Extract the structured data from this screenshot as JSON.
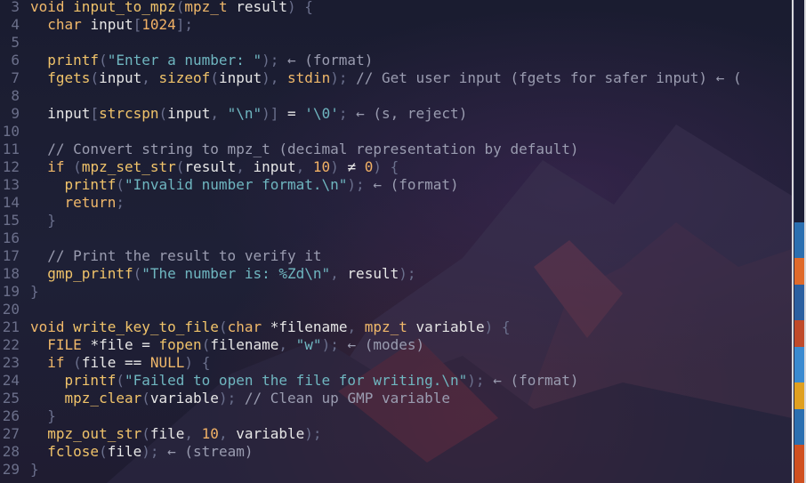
{
  "editor": {
    "lines": [
      {
        "n": "3",
        "tokens": [
          [
            "kw",
            "void "
          ],
          [
            "fn",
            "input_to_mpz"
          ],
          [
            "pn",
            "("
          ],
          [
            "ty",
            "mpz_t "
          ],
          [
            "id",
            "result"
          ],
          [
            "pn",
            ") {"
          ]
        ]
      },
      {
        "n": "4",
        "tokens": [
          [
            "id",
            "  "
          ],
          [
            "ty",
            "char "
          ],
          [
            "id",
            "input"
          ],
          [
            "pn",
            "["
          ],
          [
            "num",
            "1024"
          ],
          [
            "pn",
            "];"
          ]
        ]
      },
      {
        "n": "5",
        "tokens": []
      },
      {
        "n": "6",
        "tokens": [
          [
            "id",
            "  "
          ],
          [
            "fn",
            "printf"
          ],
          [
            "pn",
            "("
          ],
          [
            "str",
            "\"Enter a number: \""
          ],
          [
            "pn",
            "); "
          ],
          [
            "hint",
            "← (format)"
          ]
        ]
      },
      {
        "n": "7",
        "tokens": [
          [
            "id",
            "  "
          ],
          [
            "fn",
            "fgets"
          ],
          [
            "pn",
            "("
          ],
          [
            "id",
            "input"
          ],
          [
            "pn",
            ", "
          ],
          [
            "fn",
            "sizeof"
          ],
          [
            "pn",
            "("
          ],
          [
            "id",
            "input"
          ],
          [
            "pn",
            "), "
          ],
          [
            "ty",
            "stdin"
          ],
          [
            "pn",
            "); "
          ],
          [
            "cmt",
            "// Get user input (fgets for safer input) ← ("
          ]
        ]
      },
      {
        "n": "8",
        "tokens": []
      },
      {
        "n": "9",
        "tokens": [
          [
            "id",
            "  input"
          ],
          [
            "pn",
            "["
          ],
          [
            "fn",
            "strcspn"
          ],
          [
            "pn",
            "("
          ],
          [
            "id",
            "input"
          ],
          [
            "pn",
            ", "
          ],
          [
            "str",
            "\"\\n\""
          ],
          [
            "pn",
            ")] "
          ],
          [
            "op",
            "= "
          ],
          [
            "str",
            "'\\0'"
          ],
          [
            "pn",
            "; "
          ],
          [
            "hint",
            "← (s, reject)"
          ]
        ]
      },
      {
        "n": "10",
        "tokens": []
      },
      {
        "n": "11",
        "tokens": [
          [
            "cmt",
            "  // Convert string to mpz_t (decimal representation by default)"
          ]
        ]
      },
      {
        "n": "12",
        "tokens": [
          [
            "id",
            "  "
          ],
          [
            "kw",
            "if "
          ],
          [
            "pn",
            "("
          ],
          [
            "fn",
            "mpz_set_str"
          ],
          [
            "pn",
            "("
          ],
          [
            "id",
            "result"
          ],
          [
            "pn",
            ", "
          ],
          [
            "id",
            "input"
          ],
          [
            "pn",
            ", "
          ],
          [
            "num",
            "10"
          ],
          [
            "pn",
            ") "
          ],
          [
            "op",
            "≠ "
          ],
          [
            "num",
            "0"
          ],
          [
            "pn",
            ") {"
          ]
        ]
      },
      {
        "n": "13",
        "tokens": [
          [
            "id",
            "    "
          ],
          [
            "fn",
            "printf"
          ],
          [
            "pn",
            "("
          ],
          [
            "str",
            "\"Invalid number format.\\n\""
          ],
          [
            "pn",
            "); "
          ],
          [
            "hint",
            "← (format)"
          ]
        ]
      },
      {
        "n": "14",
        "tokens": [
          [
            "id",
            "    "
          ],
          [
            "kw",
            "return"
          ],
          [
            "pn",
            ";"
          ]
        ]
      },
      {
        "n": "15",
        "tokens": [
          [
            "pn",
            "  }"
          ]
        ]
      },
      {
        "n": "16",
        "tokens": []
      },
      {
        "n": "17",
        "tokens": [
          [
            "cmt",
            "  // Print the result to verify it"
          ]
        ]
      },
      {
        "n": "18",
        "tokens": [
          [
            "id",
            "  "
          ],
          [
            "fn",
            "gmp_printf"
          ],
          [
            "pn",
            "("
          ],
          [
            "str",
            "\"The number is: %Zd\\n\""
          ],
          [
            "pn",
            ", "
          ],
          [
            "id",
            "result"
          ],
          [
            "pn",
            ");"
          ]
        ]
      },
      {
        "n": "19",
        "tokens": [
          [
            "pn",
            "}"
          ]
        ]
      },
      {
        "n": "20",
        "tokens": []
      },
      {
        "n": "21",
        "tokens": [
          [
            "kw",
            "void "
          ],
          [
            "fn",
            "write_key_to_file"
          ],
          [
            "pn",
            "("
          ],
          [
            "ty",
            "char "
          ],
          [
            "op",
            "*"
          ],
          [
            "id",
            "filename"
          ],
          [
            "pn",
            ", "
          ],
          [
            "ty",
            "mpz_t "
          ],
          [
            "id",
            "variable"
          ],
          [
            "pn",
            ") {"
          ]
        ]
      },
      {
        "n": "22",
        "tokens": [
          [
            "id",
            "  "
          ],
          [
            "ty",
            "FILE "
          ],
          [
            "op",
            "*"
          ],
          [
            "id",
            "file "
          ],
          [
            "op",
            "= "
          ],
          [
            "fn",
            "fopen"
          ],
          [
            "pn",
            "("
          ],
          [
            "id",
            "filename"
          ],
          [
            "pn",
            ", "
          ],
          [
            "str",
            "\"w\""
          ],
          [
            "pn",
            "); "
          ],
          [
            "hint",
            "← (modes)"
          ]
        ]
      },
      {
        "n": "23",
        "tokens": [
          [
            "id",
            "  "
          ],
          [
            "kw",
            "if "
          ],
          [
            "pn",
            "("
          ],
          [
            "id",
            "file "
          ],
          [
            "op",
            "== "
          ],
          [
            "ty",
            "NULL"
          ],
          [
            "pn",
            ") {"
          ]
        ]
      },
      {
        "n": "24",
        "tokens": [
          [
            "id",
            "    "
          ],
          [
            "fn",
            "printf"
          ],
          [
            "pn",
            "("
          ],
          [
            "str",
            "\"Failed to open the file for writing.\\n\""
          ],
          [
            "pn",
            "); "
          ],
          [
            "hint",
            "← (format)"
          ]
        ]
      },
      {
        "n": "25",
        "tokens": [
          [
            "id",
            "    "
          ],
          [
            "fn",
            "mpz_clear"
          ],
          [
            "pn",
            "("
          ],
          [
            "id",
            "variable"
          ],
          [
            "pn",
            "); "
          ],
          [
            "cmt",
            "// Clean up GMP variable"
          ]
        ]
      },
      {
        "n": "26",
        "tokens": [
          [
            "pn",
            "  }"
          ]
        ]
      },
      {
        "n": "27",
        "tokens": [
          [
            "id",
            "  "
          ],
          [
            "fn",
            "mpz_out_str"
          ],
          [
            "pn",
            "("
          ],
          [
            "id",
            "file"
          ],
          [
            "pn",
            ", "
          ],
          [
            "num",
            "10"
          ],
          [
            "pn",
            ", "
          ],
          [
            "id",
            "variable"
          ],
          [
            "pn",
            ");"
          ]
        ]
      },
      {
        "n": "28",
        "tokens": [
          [
            "id",
            "  "
          ],
          [
            "fn",
            "fclose"
          ],
          [
            "pn",
            "("
          ],
          [
            "id",
            "file"
          ],
          [
            "pn",
            "); "
          ],
          [
            "hint",
            "← (stream)"
          ]
        ]
      },
      {
        "n": "29",
        "tokens": [
          [
            "pn",
            "}"
          ]
        ]
      }
    ]
  },
  "colors": {
    "background": "#1c1f33",
    "keyword": "#f0b86a",
    "string": "#6fb6c0",
    "comment": "#9a9cb0",
    "line_number": "#6b6f8a"
  }
}
